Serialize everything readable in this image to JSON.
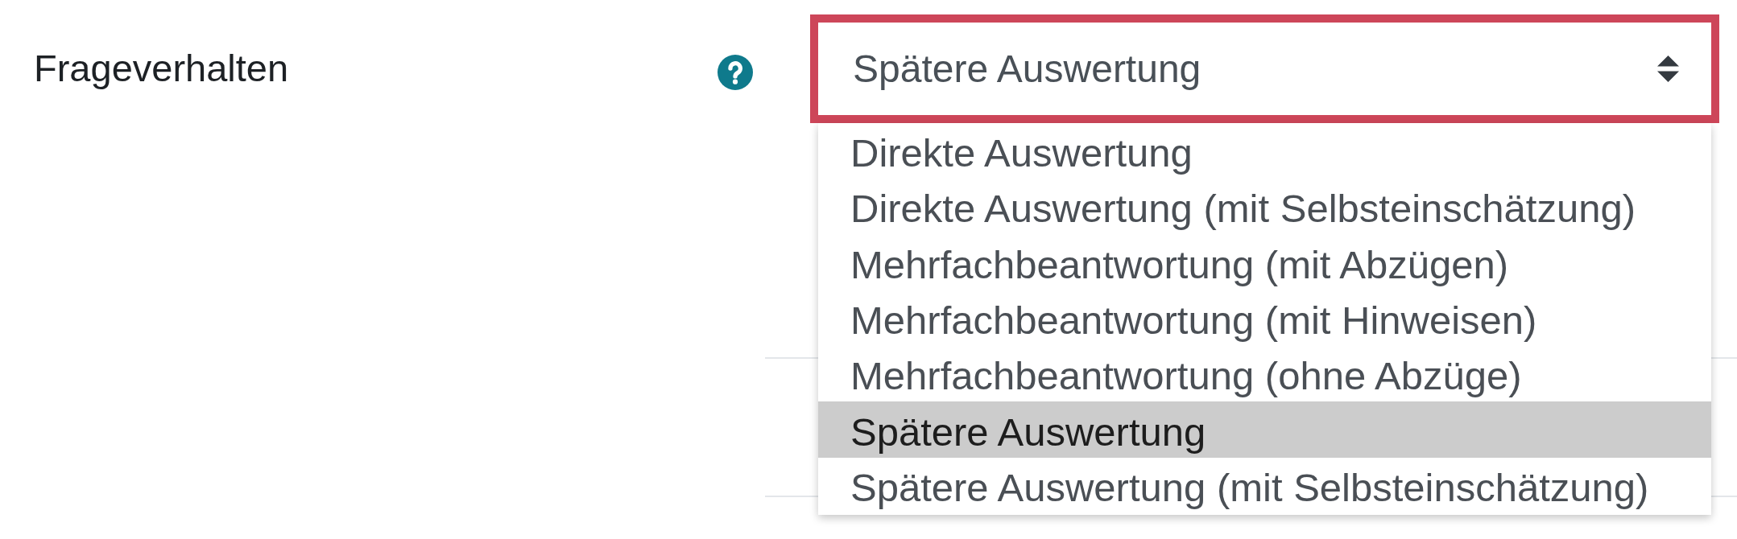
{
  "field": {
    "label": "Frageverhalten",
    "select": {
      "value": "Spätere Auswertung",
      "highlighted": true,
      "expanded": true,
      "options": [
        {
          "label": "Direkte Auswertung",
          "selected": false
        },
        {
          "label": "Direkte Auswertung (mit Selbsteinschätzung)",
          "selected": false
        },
        {
          "label": "Mehrfachbeantwortung (mit Abzügen)",
          "selected": false
        },
        {
          "label": "Mehrfachbeantwortung (mit Hinweisen)",
          "selected": false
        },
        {
          "label": "Mehrfachbeantwortung (ohne Abzüge)",
          "selected": false
        },
        {
          "label": "Spätere Auswertung",
          "selected": true
        },
        {
          "label": "Spätere Auswertung (mit Selbsteinschätzung)",
          "selected": false
        }
      ]
    }
  }
}
